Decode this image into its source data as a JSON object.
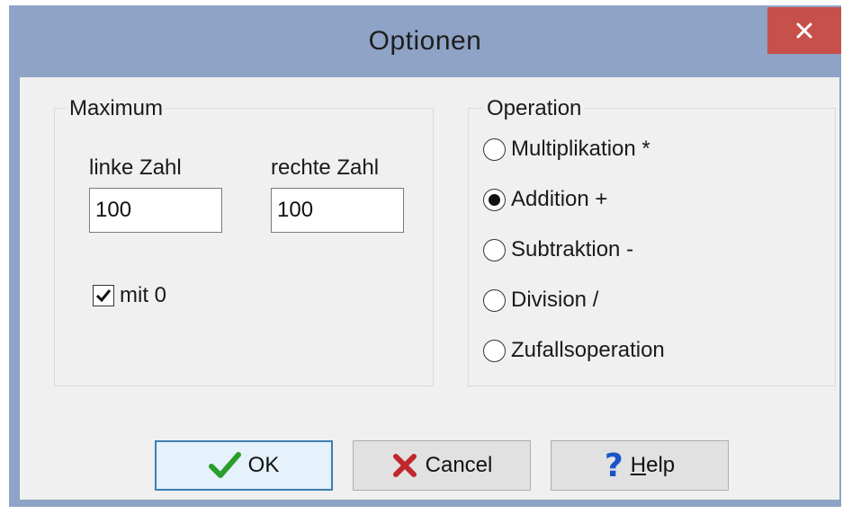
{
  "window": {
    "title": "Optionen",
    "close_label": "close"
  },
  "maximum": {
    "legend": "Maximum",
    "left_label": "linke Zahl",
    "right_label": "rechte Zahl",
    "left_value": "100",
    "right_value": "100",
    "with_zero_label": "mit 0",
    "with_zero_checked": true
  },
  "operation": {
    "legend": "Operation",
    "options": [
      {
        "label": "Multiplikation *",
        "selected": false
      },
      {
        "label": "Addition +",
        "selected": true
      },
      {
        "label": "Subtraktion -",
        "selected": false
      },
      {
        "label": "Division /",
        "selected": false
      },
      {
        "label": "Zufallsoperation",
        "selected": false
      }
    ]
  },
  "buttons": {
    "ok_label": "OK",
    "cancel_label": "Cancel",
    "help_first": "H",
    "help_rest": "elp"
  },
  "colors": {
    "title_bar": "#8ea3c6",
    "close": "#c7504a",
    "ok_icon": "#2a9d2a",
    "cancel_icon": "#c0282d",
    "help_icon": "#1a55c8"
  },
  "icons": {
    "ok": "checkmark-icon",
    "cancel": "x-icon",
    "help": "question-mark-icon",
    "close": "close-icon"
  }
}
